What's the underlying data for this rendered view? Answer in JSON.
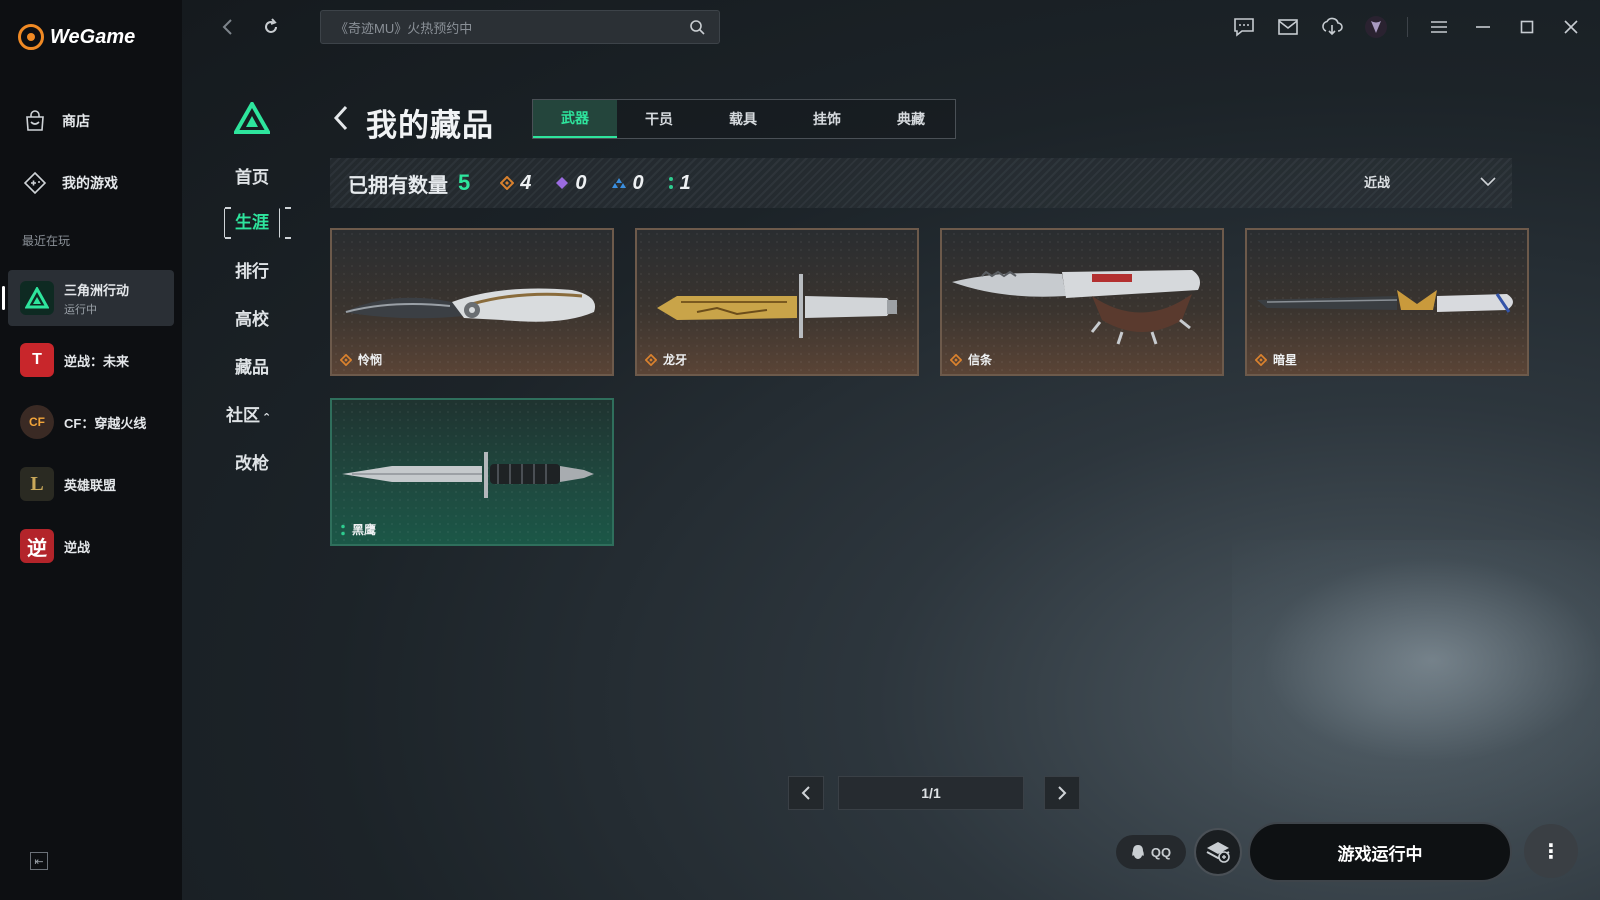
{
  "app": {
    "logo_text": "WeGame"
  },
  "sidebar": {
    "nav": [
      {
        "label": "商店",
        "icon": "store-bag-icon"
      },
      {
        "label": "我的游戏",
        "icon": "gamepad-icon"
      }
    ],
    "recent_label": "最近在玩",
    "games": [
      {
        "name": "三角洲行动",
        "status": "运行中",
        "icon_text": "",
        "color": "#0e2a22"
      },
      {
        "name": "逆战：未来",
        "status": "",
        "icon_text": "T",
        "color": "#c8262b"
      },
      {
        "name": "CF：穿越火线",
        "status": "",
        "icon_text": "CF",
        "color": "#3a2a24"
      },
      {
        "name": "英雄联盟",
        "status": "",
        "icon_text": "L",
        "color": "#2a2a22"
      },
      {
        "name": "逆战",
        "status": "",
        "icon_text": "逆",
        "color": "#b3242a"
      }
    ]
  },
  "topbar": {
    "search_placeholder": "《奇迹MU》火热预约中"
  },
  "subnav": [
    {
      "label": "首页",
      "active": false
    },
    {
      "label": "生涯",
      "active": true
    },
    {
      "label": "排行",
      "active": false
    },
    {
      "label": "高校",
      "active": false
    },
    {
      "label": "藏品",
      "active": false
    },
    {
      "label": "社区",
      "active": false,
      "caret": "⌃"
    },
    {
      "label": "改枪",
      "active": false
    }
  ],
  "page": {
    "title": "我的藏品",
    "tabs": [
      {
        "label": "武器",
        "active": true
      },
      {
        "label": "干员",
        "active": false
      },
      {
        "label": "载具",
        "active": false
      },
      {
        "label": "挂饰",
        "active": false
      },
      {
        "label": "典藏",
        "active": false
      }
    ]
  },
  "summary": {
    "label": "已拥有数量",
    "total": "5",
    "rarity_counts": [
      {
        "value": "4",
        "color": "#d9812e",
        "icon": "gold-diamond-icon"
      },
      {
        "value": "0",
        "color": "#9a6be0",
        "icon": "purple-diamond-icon"
      },
      {
        "value": "0",
        "color": "#3b8fe0",
        "icon": "blue-triangle-icon"
      },
      {
        "value": "1",
        "color": "#2ecc8f",
        "icon": "green-dots-icon"
      }
    ],
    "filter_label": "近战"
  },
  "items": [
    {
      "name": "怜悯",
      "rarity": "gold",
      "rarity_color": "#d9812e"
    },
    {
      "name": "龙牙",
      "rarity": "gold",
      "rarity_color": "#d9812e"
    },
    {
      "name": "信条",
      "rarity": "gold",
      "rarity_color": "#d9812e"
    },
    {
      "name": "暗星",
      "rarity": "gold",
      "rarity_color": "#d9812e"
    },
    {
      "name": "黑鹰",
      "rarity": "green",
      "rarity_color": "#2ecc8f"
    }
  ],
  "pagination": {
    "display": "1/1"
  },
  "bottom": {
    "qq_label": "QQ",
    "play_label": "游戏运行中",
    "more_label": "⋮"
  },
  "colors": {
    "accent": "#2ee59d",
    "gold_rarity": "#d9812e",
    "green_rarity": "#2ecc8f"
  }
}
